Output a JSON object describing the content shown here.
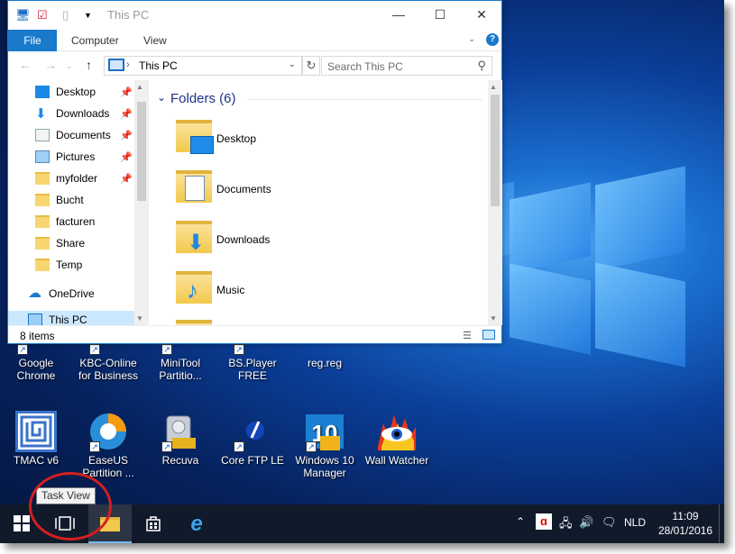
{
  "explorer": {
    "title": "This PC",
    "ribbon_tabs": {
      "file": "File",
      "computer": "Computer",
      "view": "View"
    },
    "address": "This PC",
    "search_placeholder": "Search This PC",
    "nav_items": [
      "Desktop",
      "Downloads",
      "Documents",
      "Pictures",
      "myfolder",
      "Bucht",
      "facturen",
      "Share",
      "Temp"
    ],
    "onedrive": "OneDrive",
    "thispc": "This PC",
    "group_header": "Folders (6)",
    "folders": [
      "Desktop",
      "Documents",
      "Downloads",
      "Music"
    ],
    "status_count": "8 items"
  },
  "desktop_icons_row1": [
    {
      "label1": "Google",
      "label2": "Chrome",
      "icon": "chrome-icon"
    },
    {
      "label1": "KBC-Online",
      "label2": "for Business",
      "icon": "kbc-icon"
    },
    {
      "label1": "MiniTool",
      "label2": "Partitio...",
      "icon": "minitool-icon"
    },
    {
      "label1": "BS.Player FREE",
      "label2": "",
      "icon": "bsplayer-icon"
    },
    {
      "label1": "reg.reg",
      "label2": "",
      "icon": "reg-icon"
    }
  ],
  "desktop_icons_row2": [
    {
      "label1": "TMAC v6",
      "label2": "",
      "icon": "tmac-icon"
    },
    {
      "label1": "EaseUS",
      "label2": "Partition ...",
      "icon": "easeus-icon"
    },
    {
      "label1": "Recuva",
      "label2": "",
      "icon": "recuva-icon"
    },
    {
      "label1": "Core FTP LE",
      "label2": "",
      "icon": "coreftp-icon"
    },
    {
      "label1": "Windows 10",
      "label2": "Manager",
      "icon": "windows10-manager-icon"
    },
    {
      "label1": "Wall Watcher",
      "label2": "",
      "icon": "wallwatcher-icon"
    }
  ],
  "tooltip": "Task View",
  "taskbar": {
    "language": "NLD",
    "time": "11:09",
    "date": "28/01/2016"
  },
  "colors": {
    "accent": "#1979ca",
    "taskbar": "#101a2b",
    "highlight": "#d41f1f",
    "group_header": "#1e3287"
  }
}
